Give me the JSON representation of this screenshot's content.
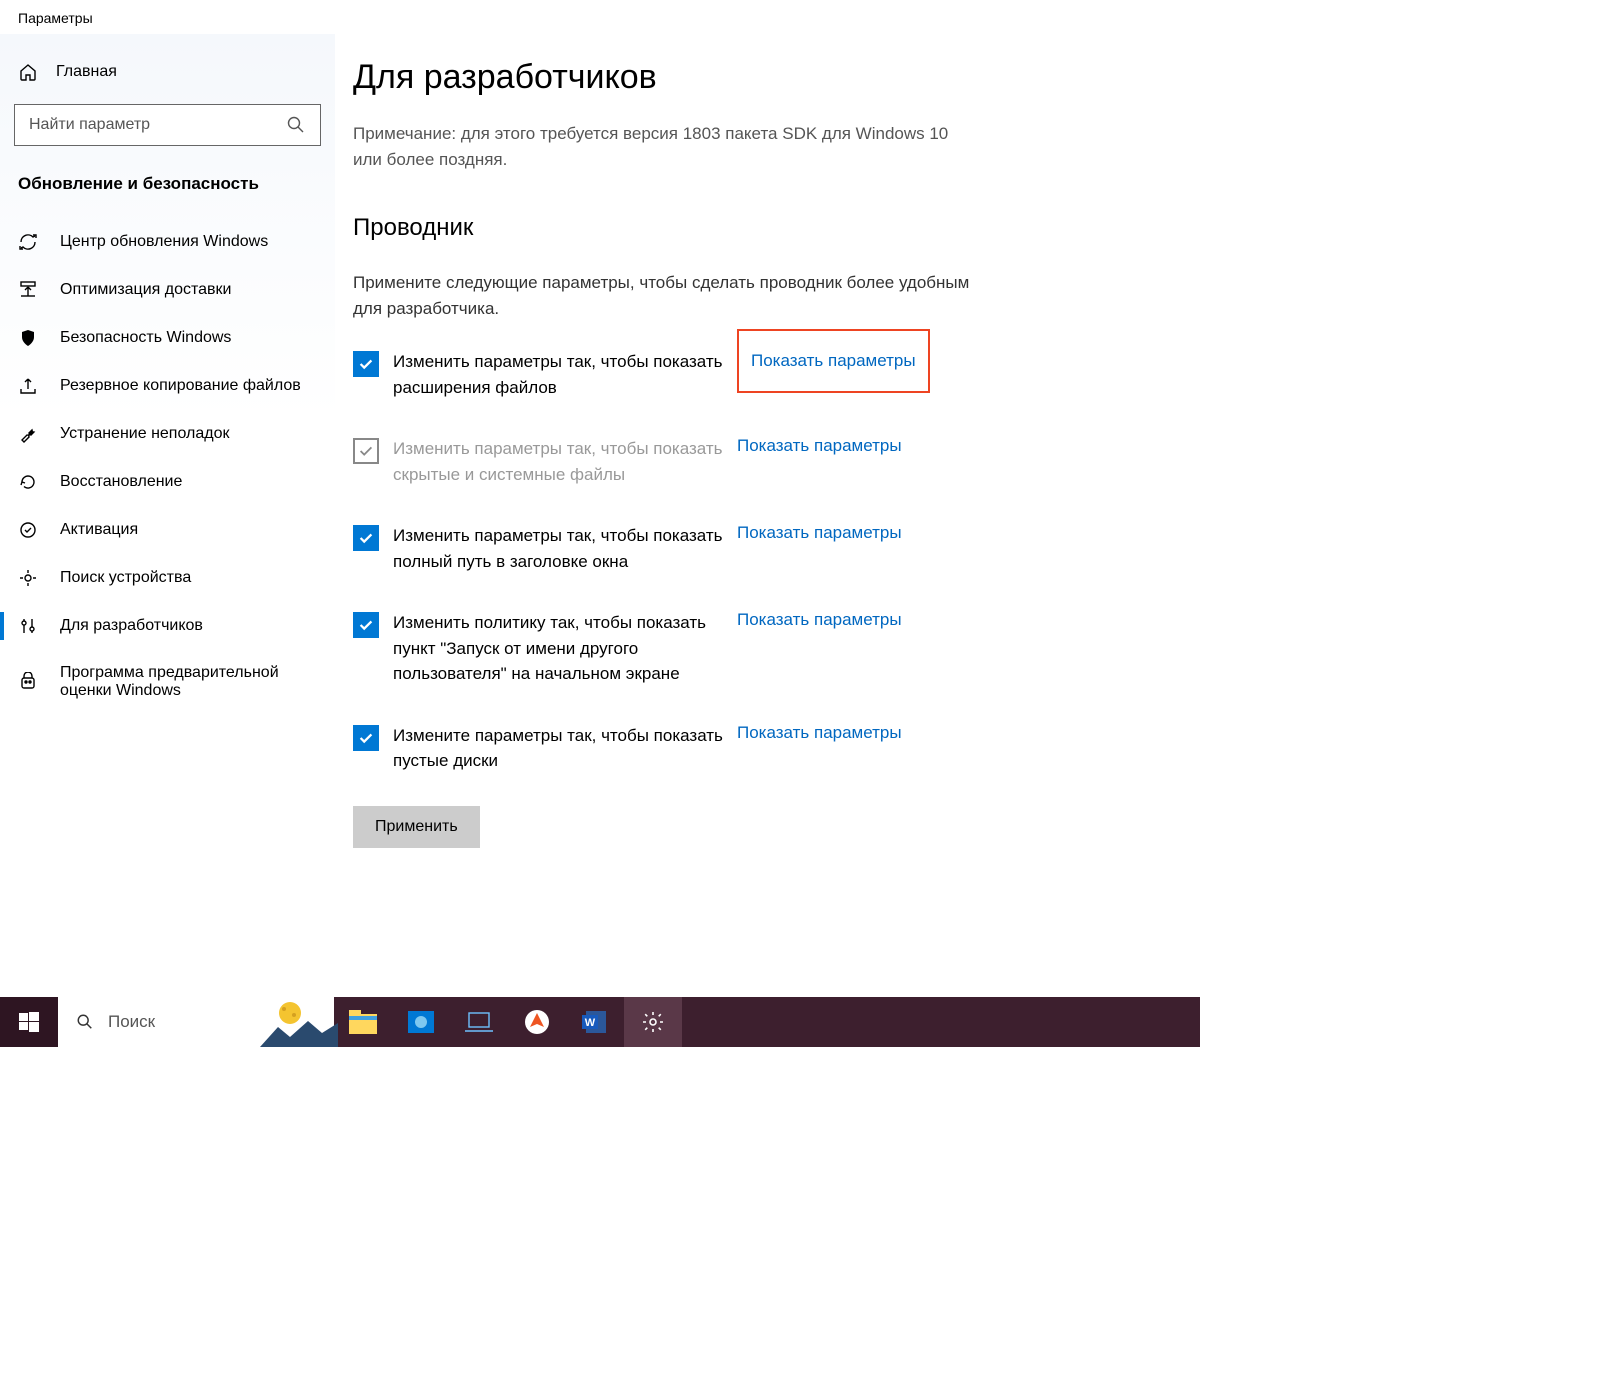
{
  "window_title": "Параметры",
  "home_label": "Главная",
  "search_placeholder": "Найти параметр",
  "section_title": "Обновление и безопасность",
  "nav": [
    {
      "id": "update",
      "label": "Центр обновления Windows"
    },
    {
      "id": "delivery",
      "label": "Оптимизация доставки"
    },
    {
      "id": "security",
      "label": "Безопасность Windows"
    },
    {
      "id": "backup",
      "label": "Резервное копирование файлов"
    },
    {
      "id": "troubleshoot",
      "label": "Устранение неполадок"
    },
    {
      "id": "recovery",
      "label": "Восстановление"
    },
    {
      "id": "activation",
      "label": "Активация"
    },
    {
      "id": "findmydevice",
      "label": "Поиск устройства"
    },
    {
      "id": "developers",
      "label": "Для разработчиков"
    },
    {
      "id": "insider",
      "label": "Программа предварительной оценки Windows"
    }
  ],
  "active_nav": "developers",
  "main": {
    "title": "Для разработчиков",
    "note": "Примечание: для этого требуется версия 1803 пакета SDK для Windows 10 или более поздняя.",
    "section_heading": "Проводник",
    "section_desc": "Примените следующие параметры, чтобы сделать проводник более удобным для разработчика.",
    "link_label": "Показать параметры",
    "options": [
      {
        "checked": true,
        "disabled": false,
        "highlight": true,
        "label": "Изменить параметры так, чтобы показать расширения файлов"
      },
      {
        "checked": true,
        "disabled": true,
        "highlight": false,
        "label": "Изменить параметры так, чтобы показать скрытые и системные файлы"
      },
      {
        "checked": true,
        "disabled": false,
        "highlight": false,
        "label": "Изменить параметры так, чтобы показать полный путь в заголовке окна"
      },
      {
        "checked": true,
        "disabled": false,
        "highlight": false,
        "label": "Изменить политику так, чтобы показать пункт \"Запуск от имени другого пользователя\" на начальном экране"
      },
      {
        "checked": true,
        "disabled": false,
        "highlight": false,
        "label": "Измените параметры так, чтобы показать пустые диски"
      }
    ],
    "apply_label": "Применить"
  },
  "taskbar": {
    "search_placeholder": "Поиск"
  },
  "colors": {
    "accent": "#0078d4",
    "link": "#0067c0",
    "highlight_border": "#e42",
    "taskbar_bg": "#3d1f2e"
  }
}
